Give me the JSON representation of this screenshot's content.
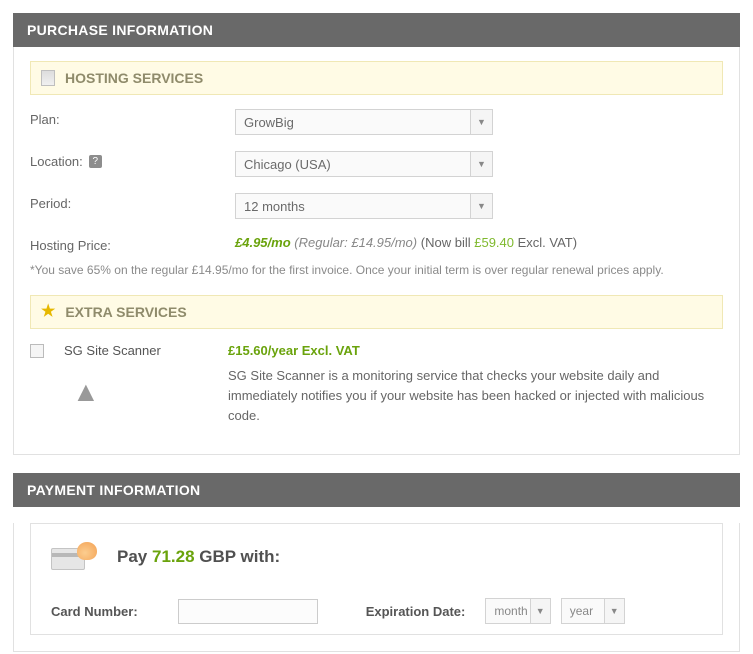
{
  "purchase": {
    "title": "PURCHASE INFORMATION",
    "hosting": {
      "header": "HOSTING SERVICES",
      "plan_label": "Plan:",
      "plan_value": "GrowBig",
      "location_label": "Location:",
      "location_value": "Chicago (USA)",
      "period_label": "Period:",
      "period_value": "12 months",
      "price_label": "Hosting Price:",
      "price_promo": "£4.95/mo",
      "price_regular_prefix": "(Regular: ",
      "price_regular": "£14.95/mo",
      "price_regular_suffix": ")",
      "now_bill_prefix": " (Now bill ",
      "now_bill_amount": "£59.40",
      "now_bill_suffix": " Excl. VAT)"
    },
    "savings_note": "*You save 65% on the regular £14.95/mo for the first invoice. Once your initial term is over regular renewal prices apply.",
    "extras": {
      "header": "EXTRA SERVICES",
      "item": {
        "name": "SG Site Scanner",
        "price": "£15.60/year Excl. VAT",
        "desc": "SG Site Scanner is a monitoring service that checks your website daily and immediately notifies you if your website has been hacked or injected with malicious code."
      }
    }
  },
  "payment": {
    "title": "PAYMENT INFORMATION",
    "pay_prefix": "Pay ",
    "pay_amount": "71.28",
    "pay_suffix": " GBP with:",
    "card_label": "Card Number:",
    "exp_label": "Expiration Date:",
    "exp_month": "month",
    "exp_year": "year"
  }
}
